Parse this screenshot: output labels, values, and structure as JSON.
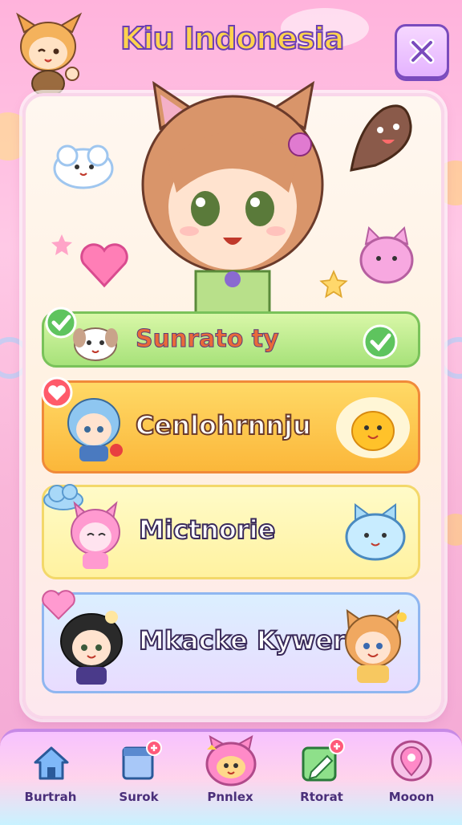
{
  "header": {
    "title": "Kiu Indonesia",
    "close_icon": "close-x-icon"
  },
  "menu": {
    "items": [
      {
        "label": "Sunrato ty",
        "icon": "puppy-icon",
        "badge": "check-icon",
        "status": "check-icon"
      },
      {
        "label": "Cenlohrnnju",
        "icon": "blue-hair-character-icon",
        "badge": "heart-icon",
        "status": "smiley-blob-icon"
      },
      {
        "label": "Mictnorie",
        "icon": "pink-bunny-character-icon",
        "badge": "cloud-icon",
        "status": "blue-cat-icon"
      },
      {
        "label": "Mkacke Kywer",
        "icon": "dark-hair-character-icon",
        "badge": "heart-icon",
        "status": "fox-girl-icon"
      }
    ]
  },
  "nav": {
    "items": [
      {
        "label": "Burtrah",
        "icon": "home-icon"
      },
      {
        "label": "Surok",
        "icon": "calendar-icon"
      },
      {
        "label": "Pnnlex",
        "icon": "cat-face-icon"
      },
      {
        "label": "Rtorat",
        "icon": "pencil-icon"
      },
      {
        "label": "Mooon",
        "icon": "location-pin-icon"
      }
    ]
  },
  "colors": {
    "title_fill": "#ffd34d",
    "title_stroke": "#6b3fb3",
    "row1": "#a7e27a",
    "row2": "#fbb73a",
    "row3": "#fff2a0",
    "row4": "#dbefff",
    "nav_text": "#4a2f7a"
  }
}
